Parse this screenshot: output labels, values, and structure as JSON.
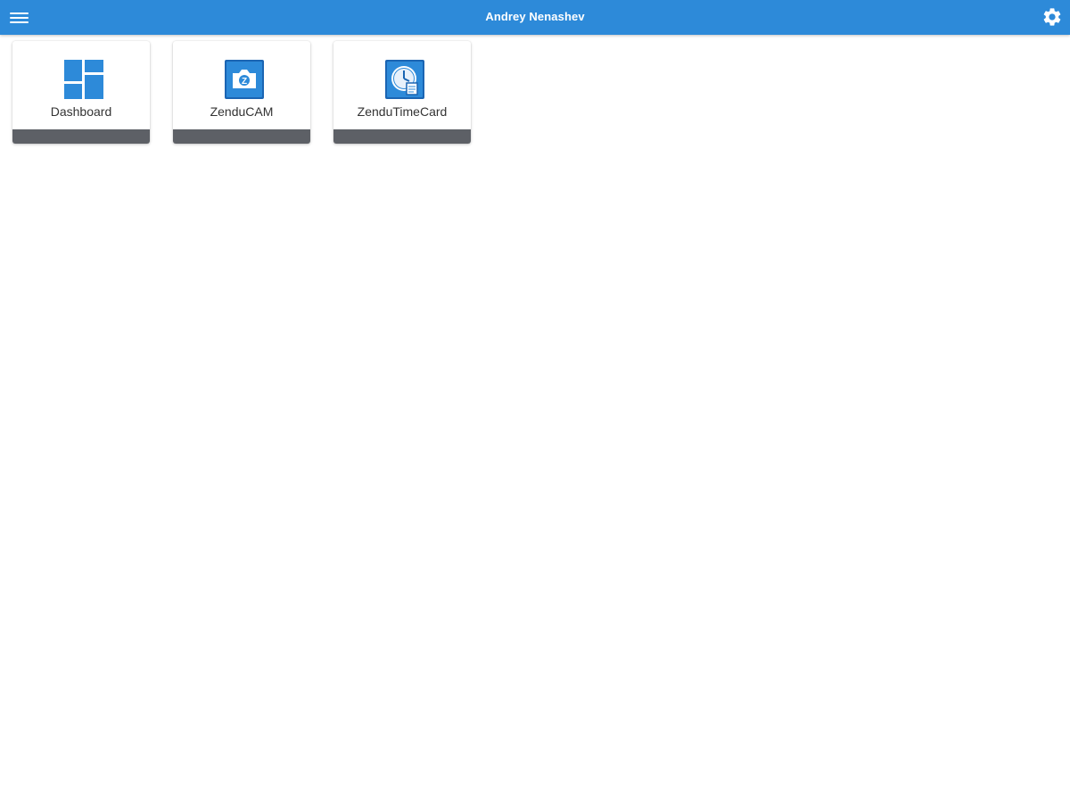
{
  "header": {
    "title": "Andrey Nenashev",
    "menu_icon": "hamburger-menu-icon",
    "settings_icon": "gear-icon"
  },
  "apps": [
    {
      "label": "Dashboard",
      "icon": "dashboard-icon"
    },
    {
      "label": "ZenduCAM",
      "icon": "zenducam-icon"
    },
    {
      "label": "ZenduTimeCard",
      "icon": "zendutimecard-icon"
    }
  ],
  "colors": {
    "app_bar": "#2d8ad9",
    "icon_blue": "#2d8ad9",
    "tile_footer": "#5d6066",
    "background": "#ffffff"
  }
}
